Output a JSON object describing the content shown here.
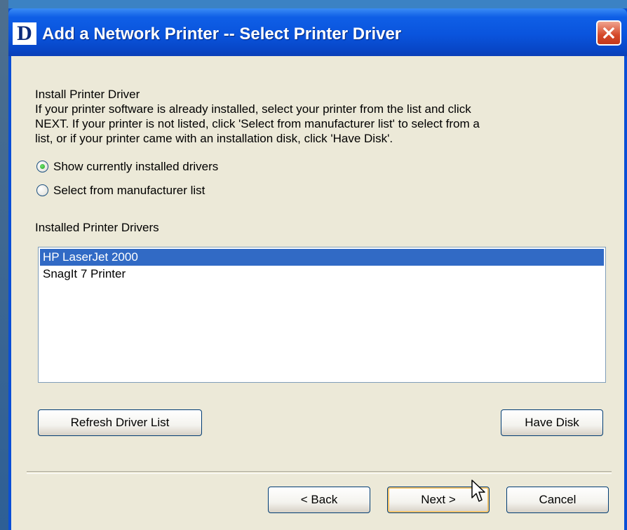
{
  "window": {
    "logo_letter": "D",
    "title": "Add a Network Printer -- Select Printer Driver"
  },
  "content": {
    "heading": "Install Printer Driver",
    "description_lines": [
      "If your printer software is already installed, select your printer from the list and click",
      "NEXT. If your printer is not listed, click 'Select from manufacturer list' to select from a",
      "list, or if your printer came with an installation disk, click 'Have Disk'."
    ],
    "options": [
      {
        "label": "Show currently installed drivers",
        "selected": true
      },
      {
        "label": "Select from manufacturer list",
        "selected": false
      }
    ],
    "list_label": "Installed Printer Drivers",
    "drivers": [
      {
        "name": "HP LaserJet 2000",
        "selected": true
      },
      {
        "name": "SnagIt 7 Printer",
        "selected": false
      }
    ]
  },
  "buttons": {
    "refresh": "Refresh Driver List",
    "have_disk": "Have Disk",
    "back": "< Back",
    "next": "Next >",
    "cancel": "Cancel"
  },
  "icons": {
    "close": "close-icon",
    "cursor": "mouse-pointer-icon"
  },
  "colors": {
    "titlebar": "#0a54dd",
    "client_bg": "#ece9d8",
    "selection": "#316ac5",
    "close_button": "#d5492a"
  }
}
